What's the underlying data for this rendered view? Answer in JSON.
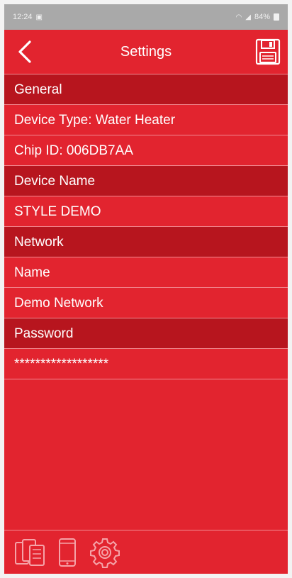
{
  "status_bar": {
    "time": "12:24",
    "battery": "84%"
  },
  "header": {
    "title": "Settings",
    "back_icon": "chevron-left-icon",
    "save_icon": "floppy-disk-icon"
  },
  "rows": [
    {
      "type": "section",
      "text": "General"
    },
    {
      "type": "item",
      "text": "Device Type: Water Heater"
    },
    {
      "type": "item",
      "text": "Chip ID: 006DB7AA"
    },
    {
      "type": "section",
      "text": "Device Name"
    },
    {
      "type": "item",
      "text": "STYLE DEMO"
    },
    {
      "type": "section",
      "text": "Network"
    },
    {
      "type": "item",
      "text": "Name"
    },
    {
      "type": "item",
      "text": "Demo Network"
    },
    {
      "type": "section",
      "text": "Password"
    },
    {
      "type": "item",
      "text": "******************"
    }
  ],
  "bottom_nav": {
    "icons": [
      "devices-icon",
      "phone-icon",
      "gear-icon"
    ]
  },
  "colors": {
    "background": "#e2242f",
    "section_background": "#b7151e",
    "divider": "#f28b92",
    "text": "#ffffff",
    "status_bar": "#a9a9a9"
  }
}
